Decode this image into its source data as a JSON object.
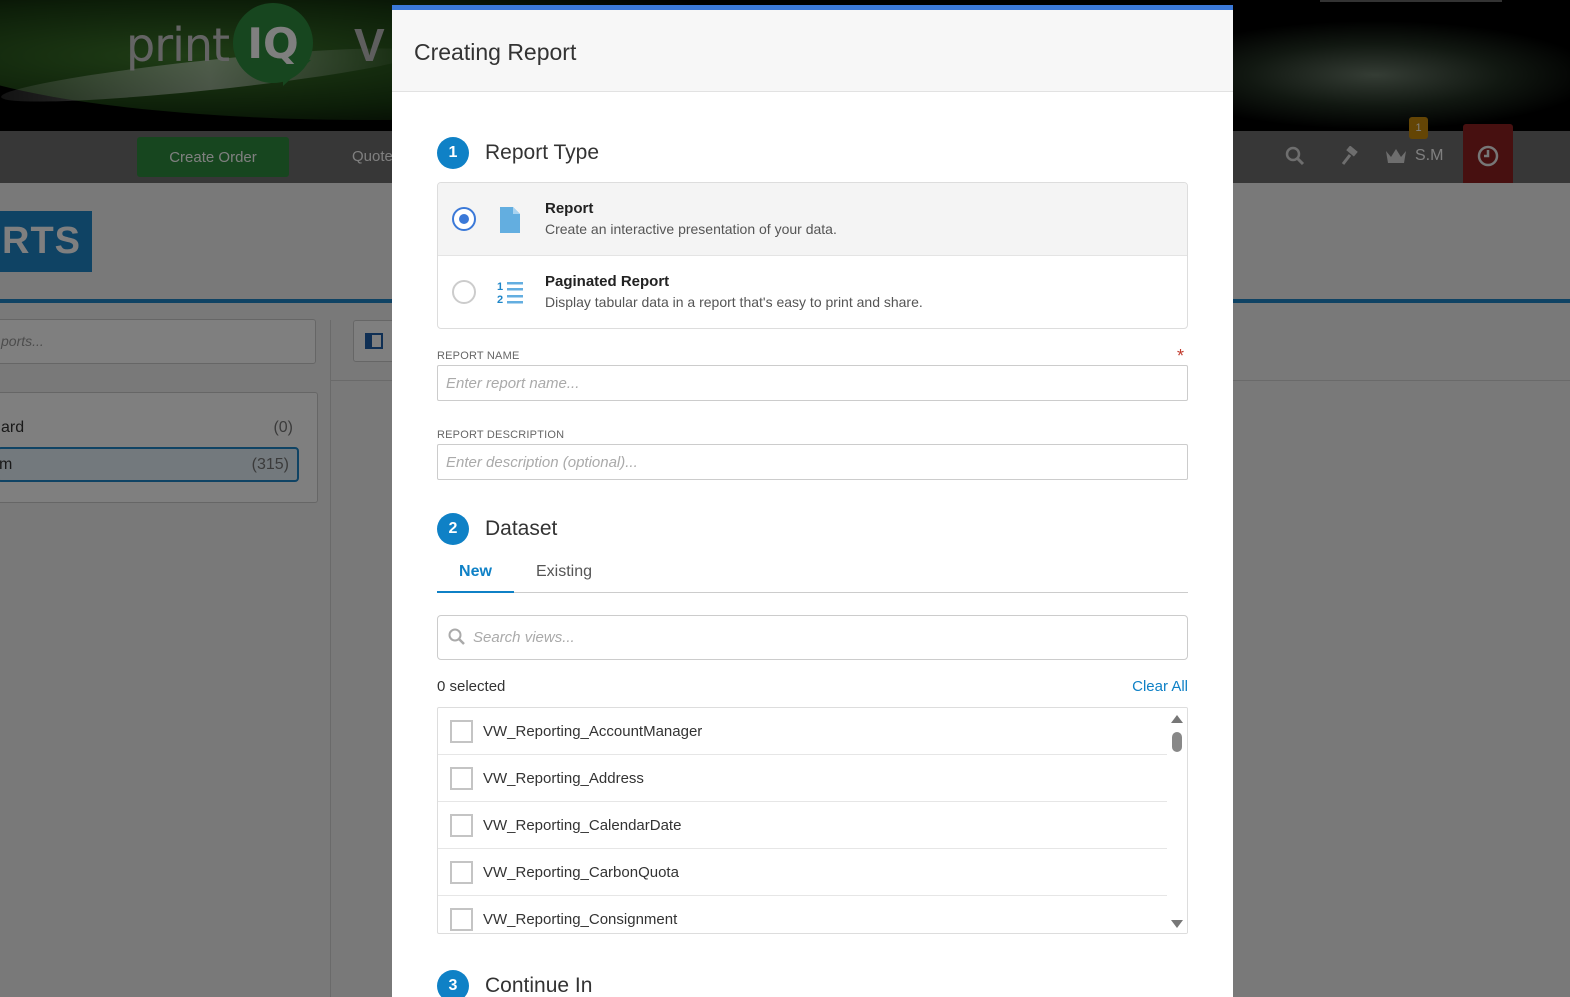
{
  "app": {
    "logo_text": "print",
    "logo_mark": "IQ",
    "logo_partial": "V",
    "nav": {
      "create_order_label": "Create Order",
      "quote_label": "Quote",
      "user_label": "S.M",
      "notification_count": "1",
      "icons": [
        "search-icon",
        "hammer-icon",
        "crown-icon",
        "clock-icon"
      ]
    },
    "page_title": "RTS",
    "search_placeholder": "ports...",
    "folders": [
      {
        "label": "ard",
        "count": "(0)"
      },
      {
        "label": "m",
        "count": "(315)"
      }
    ]
  },
  "modal": {
    "title": "Creating Report",
    "step1": {
      "number": "1",
      "title": "Report Type",
      "options": [
        {
          "label": "Report",
          "description": "Create an interactive presentation of your data.",
          "icon": "document-icon",
          "selected": true
        },
        {
          "label": "Paginated Report",
          "description": "Display tabular data in a report that's easy to print and share.",
          "icon": "numbered-list-icon",
          "selected": false
        }
      ]
    },
    "report_name": {
      "label": "REPORT NAME",
      "required_mark": "*",
      "placeholder": "Enter report name..."
    },
    "report_description": {
      "label": "REPORT DESCRIPTION",
      "placeholder": "Enter description (optional)..."
    },
    "step2": {
      "number": "2",
      "title": "Dataset",
      "tabs": [
        {
          "label": "New",
          "active": true
        },
        {
          "label": "Existing",
          "active": false
        }
      ],
      "search_placeholder": "Search views...",
      "selected_count": "0 selected",
      "clear_all": "Clear All",
      "views": [
        "VW_Reporting_AccountManager",
        "VW_Reporting_Address",
        "VW_Reporting_CalendarDate",
        "VW_Reporting_CarbonQuota",
        "VW_Reporting_Consignment"
      ]
    },
    "step3": {
      "number": "3",
      "title": "Continue In"
    }
  },
  "colors": {
    "accent": "#0f81c6",
    "modal_top_border": "#3b79d8",
    "brand_green": "#2e8d3e",
    "required": "#c0392b",
    "timer_red": "#8f2121"
  }
}
